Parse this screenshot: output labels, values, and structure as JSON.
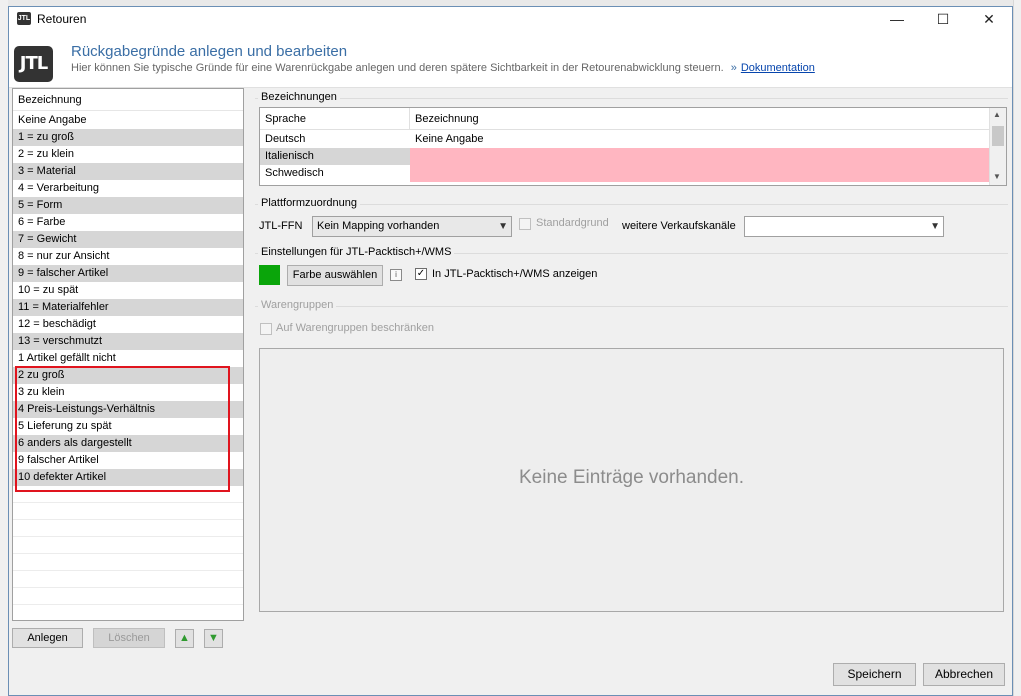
{
  "window": {
    "title": "Retouren",
    "icon": "jtl-app-icon",
    "controls": {
      "minimize": "—",
      "maximize": "☐",
      "close": "✕"
    }
  },
  "header": {
    "logo_text": "JTL",
    "title": "Rückgabegründe anlegen und bearbeiten",
    "subtitle": "Hier können Sie typische Gründe für eine Warenrückgabe anlegen und deren spätere Sichtbarkeit in der Retourenabwicklung steuern.",
    "link_prefix": "»",
    "link_text": "Dokumentation"
  },
  "reasons": {
    "column_header": "Bezeichnung",
    "items": [
      "Keine Angabe",
      "1 = zu groß",
      "2 = zu klein",
      "3 = Material",
      "4 = Verarbeitung",
      "5 = Form",
      "6 = Farbe",
      "7 = Gewicht",
      "8 = nur zur Ansicht",
      "9 = falscher Artikel",
      "10 = zu spät",
      "11 = Materialfehler",
      "12 = beschädigt",
      "13 = verschmutzt",
      "1 Artikel gefällt nicht",
      "2 zu groß",
      "3 zu klein",
      "4 Preis-Leistungs-Verhältnis",
      "5 Lieferung zu spät",
      "6 anders als dargestellt",
      "9 falscher Artikel",
      "10 defekter Artikel"
    ],
    "highlight_color": "#e0141e"
  },
  "buttons": {
    "create": "Anlegen",
    "delete": "Löschen",
    "move_up": "▲",
    "move_down": "▼",
    "save": "Speichern",
    "cancel": "Abbrechen"
  },
  "translations": {
    "group_label": "Bezeichnungen",
    "columns": [
      "Sprache",
      "Bezeichnung"
    ],
    "rows": [
      {
        "language": "Deutsch",
        "value": "Keine Angabe"
      },
      {
        "language": "Italienisch",
        "value": ""
      },
      {
        "language": "Schwedisch",
        "value": ""
      }
    ],
    "missing_color": "#ffb6c1"
  },
  "platform": {
    "group_label": "Plattformzuordnung",
    "ffn_label": "JTL-FFN",
    "ffn_value": "Kein Mapping vorhanden",
    "default_reason_label": "Standardgrund",
    "more_channels_label": "weitere Verkaufskanäle",
    "more_channels_value": ""
  },
  "packtisch": {
    "group_label": "Einstellungen für JTL-Packtisch+/WMS",
    "color": "#0aa50a",
    "choose_color_label": "Farbe auswählen",
    "info_icon": "info-icon",
    "show_label": "In JTL-Packtisch+/WMS anzeigen",
    "show_checked": true
  },
  "product_groups": {
    "group_label": "Warengruppen",
    "restrict_label": "Auf  Warengruppen beschränken",
    "empty_text": "Keine Einträge vorhanden."
  }
}
